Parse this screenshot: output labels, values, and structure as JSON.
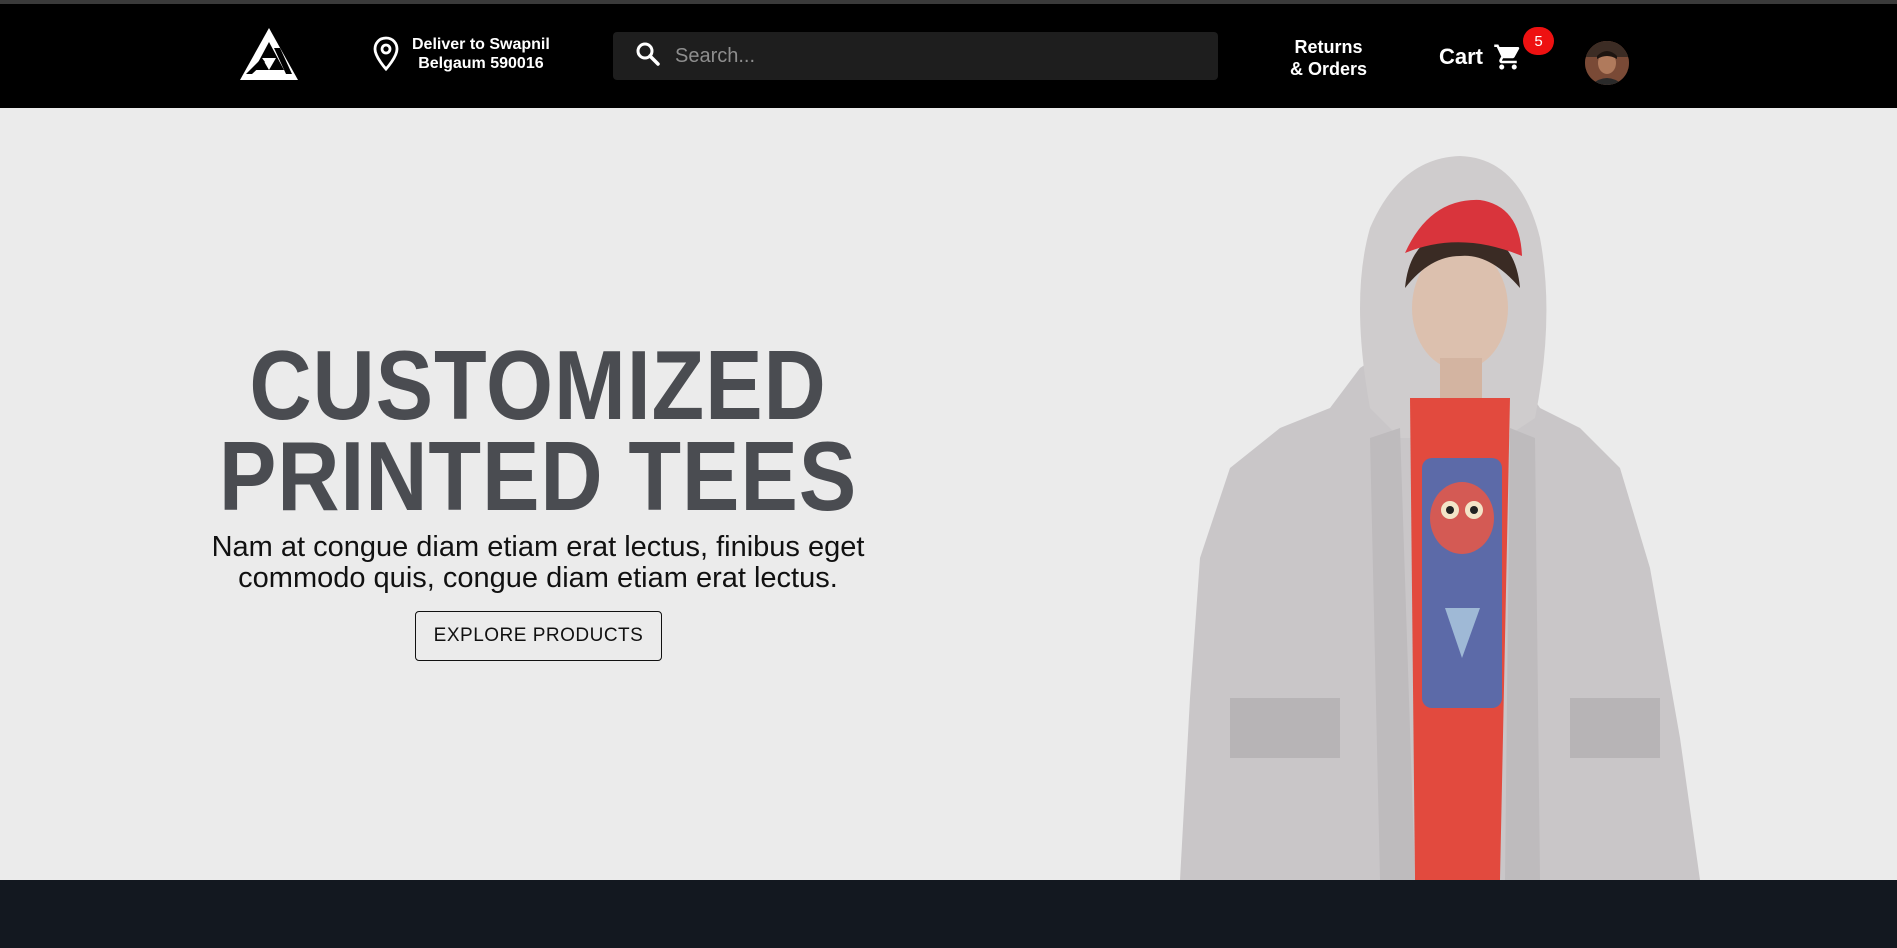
{
  "header": {
    "deliver_line1": "Deliver to Swapnil",
    "deliver_line2": "Belgaum 590016",
    "search_placeholder": "Search...",
    "returns_line1": "Returns",
    "returns_line2": "& Orders",
    "cart_label": "Cart",
    "cart_count": "5"
  },
  "hero": {
    "headline_line1": "CUSTOMIZED",
    "headline_line2": "PRINTED TEES",
    "subtext_line1": "Nam at congue diam etiam erat lectus, finibus eget",
    "subtext_line2": "commodo quis, congue diam etiam erat lectus.",
    "cta_label": "EXPLORE PRODUCTS"
  },
  "colors": {
    "navbar": "#000000",
    "hero_bg": "#ebebeb",
    "headline": "#4a4c51",
    "badge": "#ee1111",
    "footer": "#131820"
  },
  "icons": [
    "logo-icon",
    "location-pin-icon",
    "search-icon",
    "cart-icon"
  ]
}
